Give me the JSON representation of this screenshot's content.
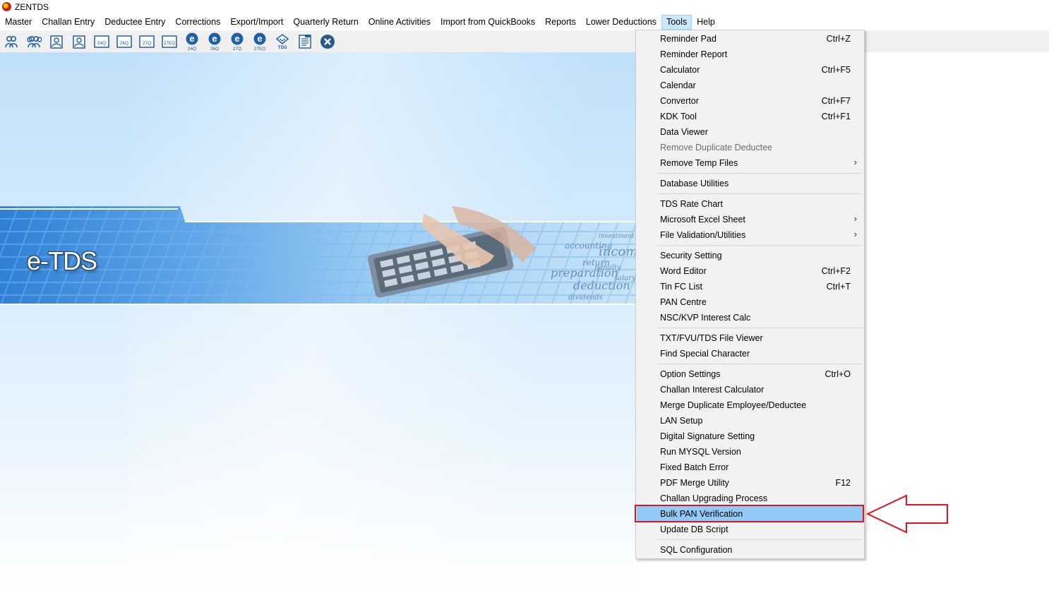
{
  "window": {
    "title": "ZENTDS"
  },
  "menubar": {
    "items": [
      {
        "label": "Master",
        "active": false
      },
      {
        "label": "Challan Entry",
        "active": false
      },
      {
        "label": "Deductee Entry",
        "active": false
      },
      {
        "label": "Corrections",
        "active": false
      },
      {
        "label": "Export/Import",
        "active": false
      },
      {
        "label": "Quarterly Return",
        "active": false
      },
      {
        "label": "Online Activities",
        "active": false
      },
      {
        "label": "Import from QuickBooks",
        "active": false
      },
      {
        "label": "Reports",
        "active": false
      },
      {
        "label": "Lower Deductions",
        "active": false
      },
      {
        "label": "Tools",
        "active": true
      },
      {
        "label": "Help",
        "active": false
      }
    ]
  },
  "toolbar": {
    "buttons": [
      {
        "icon": "users-icon",
        "label": ""
      },
      {
        "icon": "group-icon",
        "label": ""
      },
      {
        "icon": "person-form-icon",
        "label": ""
      },
      {
        "icon": "person-form-icon",
        "label": ""
      },
      {
        "icon": "form-24q-icon",
        "label": "24Q"
      },
      {
        "icon": "form-26q-icon",
        "label": "26Q"
      },
      {
        "icon": "form-27q-icon",
        "label": "27Q"
      },
      {
        "icon": "form-27eq-icon",
        "label": "27EQ"
      },
      {
        "icon": "e-24q-icon",
        "label": "24Q"
      },
      {
        "icon": "e-26q-icon",
        "label": "26Q"
      },
      {
        "icon": "e-27q-icon",
        "label": "27Q"
      },
      {
        "icon": "e-27eq-icon",
        "label": "27EQ"
      },
      {
        "icon": "tds-logo-icon",
        "label": "TDS"
      },
      {
        "icon": "report-icon",
        "label": ""
      },
      {
        "icon": "close-icon",
        "label": ""
      }
    ]
  },
  "banner": {
    "text": "e-TDS"
  },
  "tools_menu": {
    "items": [
      {
        "label": "Reminder Pad",
        "shortcut": "Ctrl+Z"
      },
      {
        "label": "Reminder Report",
        "shortcut": ""
      },
      {
        "label": "Calculator",
        "shortcut": "Ctrl+F5"
      },
      {
        "label": "Calendar",
        "shortcut": ""
      },
      {
        "label": "Convertor",
        "shortcut": "Ctrl+F7"
      },
      {
        "label": "KDK Tool",
        "shortcut": "Ctrl+F1"
      },
      {
        "label": "Data Viewer",
        "shortcut": ""
      },
      {
        "label": "Remove Duplicate Deductee",
        "shortcut": "",
        "disabled": true
      },
      {
        "label": "Remove Temp Files",
        "shortcut": "",
        "submenu": true
      },
      {
        "separator": true
      },
      {
        "label": "Database Utilities",
        "shortcut": ""
      },
      {
        "separator": true
      },
      {
        "label": "TDS Rate Chart",
        "shortcut": ""
      },
      {
        "label": "Microsoft Excel Sheet",
        "shortcut": "",
        "submenu": true
      },
      {
        "label": "File Validation/Utilities",
        "shortcut": "",
        "submenu": true
      },
      {
        "separator": true
      },
      {
        "label": "Security Setting",
        "shortcut": ""
      },
      {
        "label": "Word Editor",
        "shortcut": "Ctrl+F2"
      },
      {
        "label": "Tin FC List",
        "shortcut": "Ctrl+T"
      },
      {
        "label": "PAN Centre",
        "shortcut": ""
      },
      {
        "label": "NSC/KVP Interest Calc",
        "shortcut": ""
      },
      {
        "separator": true
      },
      {
        "label": "TXT/FVU/TDS File Viewer",
        "shortcut": ""
      },
      {
        "label": "Find Special Character",
        "shortcut": ""
      },
      {
        "separator": true
      },
      {
        "label": "Option Settings",
        "shortcut": "Ctrl+O"
      },
      {
        "label": "Challan Interest Calculator",
        "shortcut": ""
      },
      {
        "label": "Merge Duplicate Employee/Deductee",
        "shortcut": ""
      },
      {
        "label": "LAN Setup",
        "shortcut": ""
      },
      {
        "label": "Digital Signature Setting",
        "shortcut": ""
      },
      {
        "label": "Run MYSQL Version",
        "shortcut": ""
      },
      {
        "label": "Fixed Batch Error",
        "shortcut": ""
      },
      {
        "label": "PDF Merge Utility",
        "shortcut": "F12"
      },
      {
        "label": "Challan Upgrading Process",
        "shortcut": ""
      },
      {
        "label": "Bulk PAN Verification",
        "shortcut": "",
        "highlighted": true
      },
      {
        "label": "Update DB Script",
        "shortcut": ""
      },
      {
        "separator": true
      },
      {
        "label": "SQL Configuration",
        "shortcut": ""
      }
    ]
  },
  "colors": {
    "menu_highlight": "#91c9f7",
    "annotation_red": "#e0141e",
    "canvas_blue": "#bfe0fa"
  }
}
